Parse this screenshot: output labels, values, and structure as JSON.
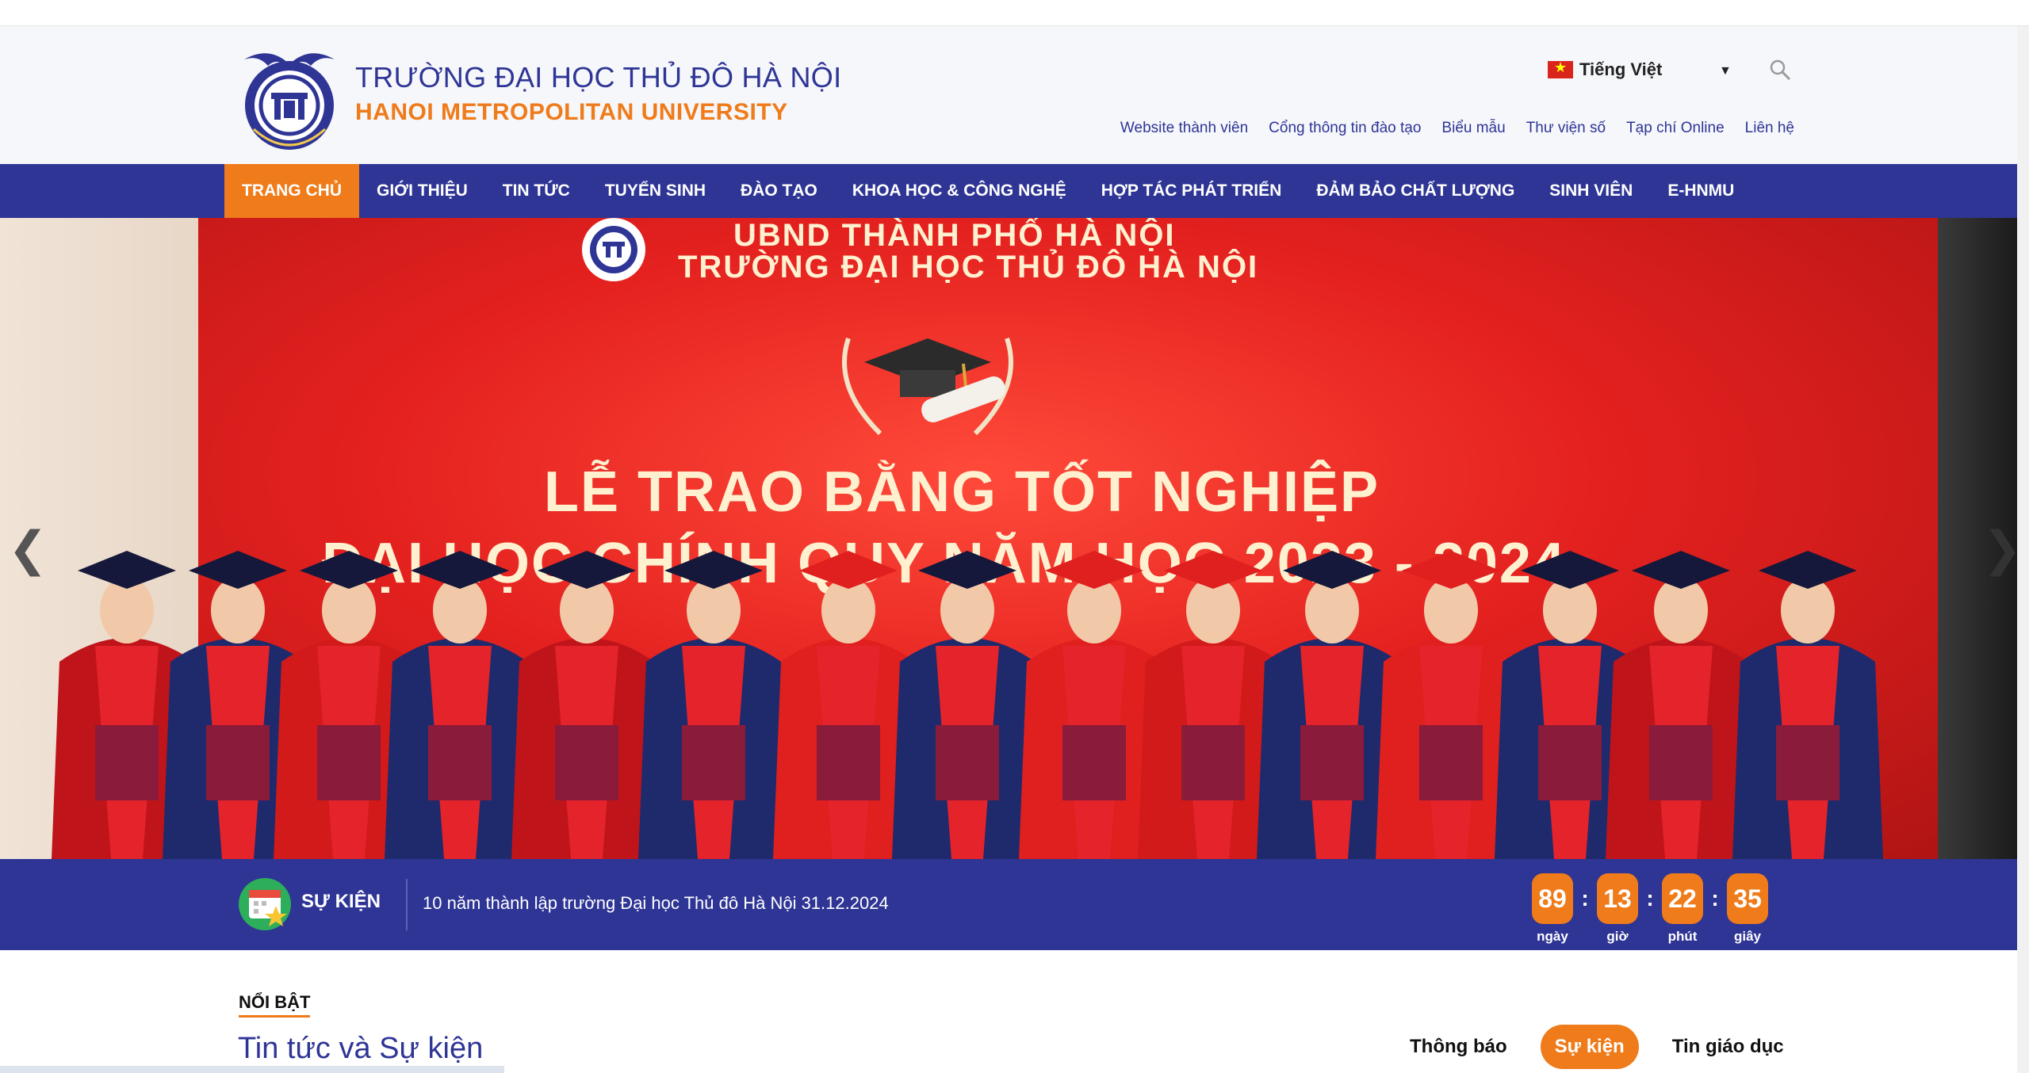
{
  "header": {
    "brand_vi": "TRƯỜNG ĐẠI HỌC THỦ ĐÔ HÀ NỘI",
    "brand_en": "HANOI METROPOLITAN UNIVERSITY",
    "language": "Tiếng Việt",
    "links": [
      "Website thành viên",
      "Cổng thông tin đào tạo",
      "Biểu mẫu",
      "Thư viện số",
      "Tạp chí Online",
      "Liên hệ"
    ]
  },
  "nav": {
    "items": [
      "TRANG CHỦ",
      "GIỚI THIỆU",
      "TIN TỨC",
      "TUYỂN SINH",
      "ĐÀO TẠO",
      "KHOA HỌC & CÔNG NGHỆ",
      "HỢP TÁC PHÁT TRIỂN",
      "ĐẢM BẢO CHẤT LƯỢNG",
      "SINH VIÊN",
      "E-HNMU"
    ],
    "active_index": 0
  },
  "slide": {
    "subtitle_1": "UBND THÀNH PHỐ HÀ NỘI",
    "subtitle_2": "TRƯỜNG ĐẠI HỌC THỦ ĐÔ HÀ NỘI",
    "title_1": "LỄ TRAO BẰNG TỐT NGHIỆP",
    "title_2": "ĐẠI HỌC CHÍNH QUY NĂM HỌC 2023 - 2024"
  },
  "events": {
    "label": "SỰ KIỆN",
    "text": "10 năm thành lập trường Đại học Thủ đô Hà Nội 31.12.2024",
    "countdown": [
      {
        "value": "89",
        "unit": "ngày"
      },
      {
        "value": "13",
        "unit": "giờ"
      },
      {
        "value": "22",
        "unit": "phút"
      },
      {
        "value": "35",
        "unit": "giây"
      }
    ],
    "separator": ":"
  },
  "featured": {
    "kicker": "NỔI BẬT",
    "title": "Tin tức và Sự kiện",
    "tabs": [
      "Thông báo",
      "Sự kiện",
      "Tin giáo dục"
    ],
    "active_tab": 1
  },
  "colors": {
    "primary": "#2e3595",
    "accent": "#ef7b1a",
    "banner_red": "#e4211f"
  }
}
